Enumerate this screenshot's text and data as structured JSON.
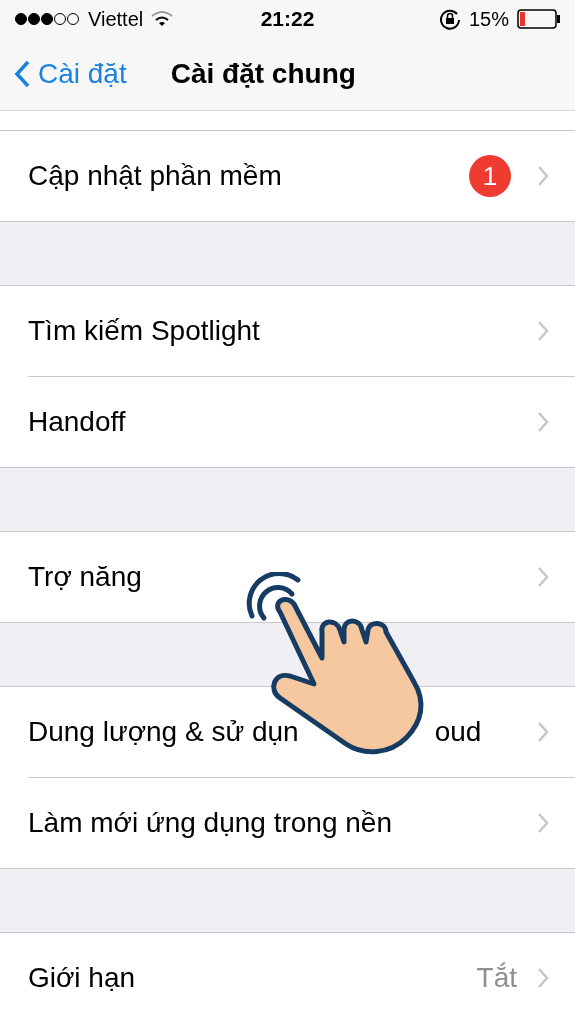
{
  "status_bar": {
    "carrier": "Viettel",
    "time": "21:22",
    "battery_percent": "15%"
  },
  "nav": {
    "back_label": "Cài đặt",
    "title": "Cài đặt chung"
  },
  "groups": [
    {
      "rows": [
        {
          "label": "Cập nhật phần mềm",
          "badge": "1"
        }
      ]
    },
    {
      "rows": [
        {
          "label": "Tìm kiếm Spotlight"
        },
        {
          "label": "Handoff"
        }
      ]
    },
    {
      "rows": [
        {
          "label": "Trợ năng"
        }
      ]
    },
    {
      "rows": [
        {
          "label": "Dung lượng & sử dụn",
          "label_tail": "oud"
        },
        {
          "label": "Làm mới ứng dụng trong nền"
        }
      ]
    },
    {
      "rows": [
        {
          "label": "Giới hạn",
          "value": "Tắt"
        }
      ]
    }
  ]
}
